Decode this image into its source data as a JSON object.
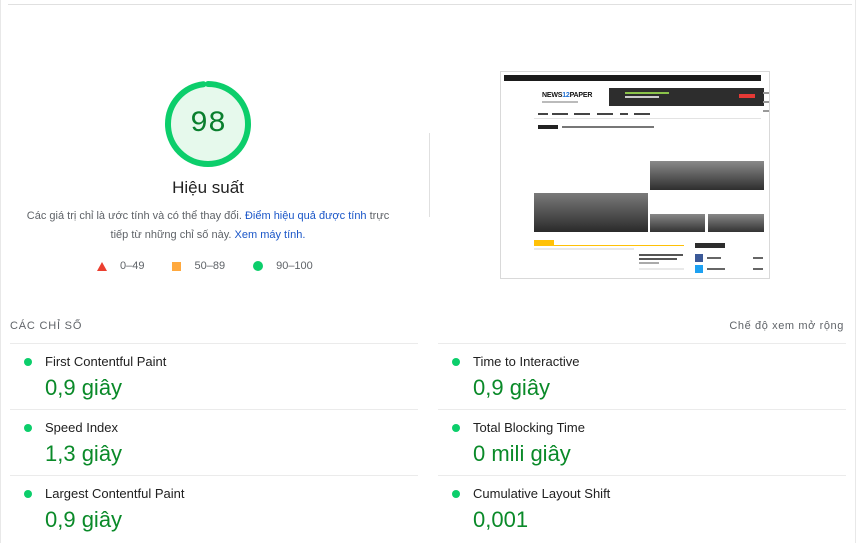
{
  "score": {
    "value": "98",
    "fraction": 0.98,
    "color": "#0cce6b",
    "title": "Hiệu suất"
  },
  "note": {
    "text1": "Các giá trị chỉ là ước tính và có thể thay đổi.",
    "link1": "Điểm hiệu quả được tính",
    "text2": "trực tiếp từ những chỉ số này.",
    "link2": "Xem máy tính."
  },
  "legend": {
    "fail": "0–49",
    "average": "50–89",
    "pass": "90–100"
  },
  "thumbnail": {
    "logo_a": "NEWS",
    "logo_b": "12",
    "logo_c": "PAPER"
  },
  "metrics": {
    "header": "CÁC CHỈ SỐ",
    "expand_label": "Chế độ xem mở rộng",
    "items": [
      {
        "name": "First Contentful Paint",
        "value": "0,9 giây"
      },
      {
        "name": "Time to Interactive",
        "value": "0,9 giây"
      },
      {
        "name": "Speed Index",
        "value": "1,3 giây"
      },
      {
        "name": "Total Blocking Time",
        "value": "0 mili giây"
      },
      {
        "name": "Largest Contentful Paint",
        "value": "0,9 giây"
      },
      {
        "name": "Cumulative Layout Shift",
        "value": "0,001"
      }
    ]
  },
  "colors": {
    "pass": "#0cce6b",
    "pass_text": "#0a8a29",
    "average": "#ffa93e",
    "fail": "#eb3f2f",
    "link": "#1a56c8"
  }
}
